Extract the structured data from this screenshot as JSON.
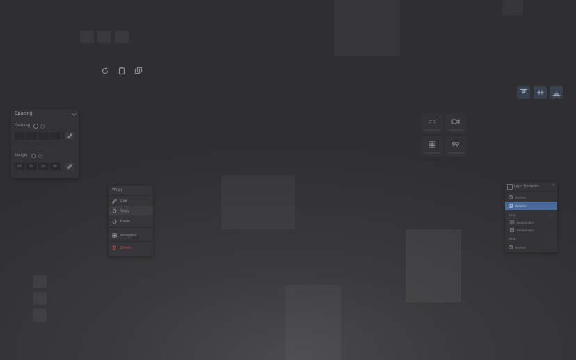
{
  "spacing_panel": {
    "title": "Spacing",
    "padding_label": "Padding",
    "margin_label": "Margin",
    "margin_values": [
      "20",
      "20",
      "20",
      "20"
    ]
  },
  "context_menu": {
    "title": "Wrap",
    "items": [
      {
        "label": "Edit",
        "icon": "pencil-icon"
      },
      {
        "label": "Copy",
        "icon": "copy-icon"
      },
      {
        "label": "Paste",
        "icon": "paste-icon"
      },
      {
        "label": "Navigator",
        "icon": "navigator-icon"
      },
      {
        "label": "Delete",
        "icon": "trash-icon"
      }
    ],
    "delete_color": "#b84a4a"
  },
  "layer_navigator": {
    "title": "Layer Navigator",
    "rows": [
      "Section",
      "Column",
      "Wrap",
      "Nested item",
      "Nested item",
      "Wrap",
      "Section"
    ]
  },
  "colors": {
    "accent": "#4a6a9c",
    "panel": "#333335"
  }
}
